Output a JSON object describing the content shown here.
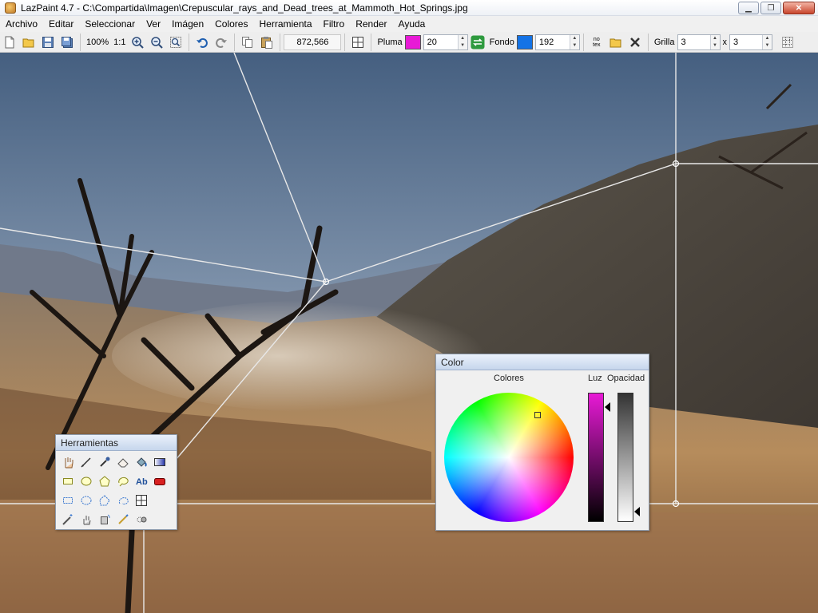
{
  "window": {
    "title": "LazPaint 4.7 - C:\\Compartida\\Imagen\\Crepuscular_rays_and_Dead_trees_at_Mammoth_Hot_Springs.jpg",
    "minimize_label": "▁",
    "maximize_label": "❐",
    "close_label": "✕"
  },
  "menu": {
    "items": [
      "Archivo",
      "Editar",
      "Seleccionar",
      "Ver",
      "Imágen",
      "Colores",
      "Herramienta",
      "Filtro",
      "Render",
      "Ayuda"
    ]
  },
  "toolbar": {
    "zoom": "100%",
    "zoom_actual": "1:1",
    "coords": "872,566",
    "pen_label": "Pluma",
    "pen_color": "#e81ad6",
    "pen_width": "20",
    "back_label": "Fondo",
    "back_color": "#1473e6",
    "back_alpha": "192",
    "notext_label": "no tex",
    "grid_label": "Grilla",
    "grid_x": "3",
    "grid_times": "x",
    "grid_y": "3"
  },
  "tools_panel": {
    "title": "Herramientas",
    "rows": [
      [
        "hand-icon",
        "pen-icon",
        "color-picker-icon",
        "eraser-icon",
        "fill-bucket-icon",
        "gradient-icon"
      ],
      [
        "rectangle-icon",
        "ellipse-icon",
        "polygon-icon",
        "lasso-shape-icon",
        "text-icon",
        "rounded-rect-icon"
      ],
      [
        "select-rect-icon",
        "select-ellipse-icon",
        "select-poly-icon",
        "select-lasso-icon",
        "deform-grid-icon"
      ],
      [
        "magic-wand-icon",
        "move-selection-icon",
        "rotate-selection-icon",
        "select-pen-icon",
        "clone-icon"
      ]
    ]
  },
  "color_panel": {
    "title": "Color",
    "colors_label": "Colores",
    "light_label": "Luz",
    "opacity_label": "Opacidad",
    "selected_color": "#e81ad6"
  }
}
